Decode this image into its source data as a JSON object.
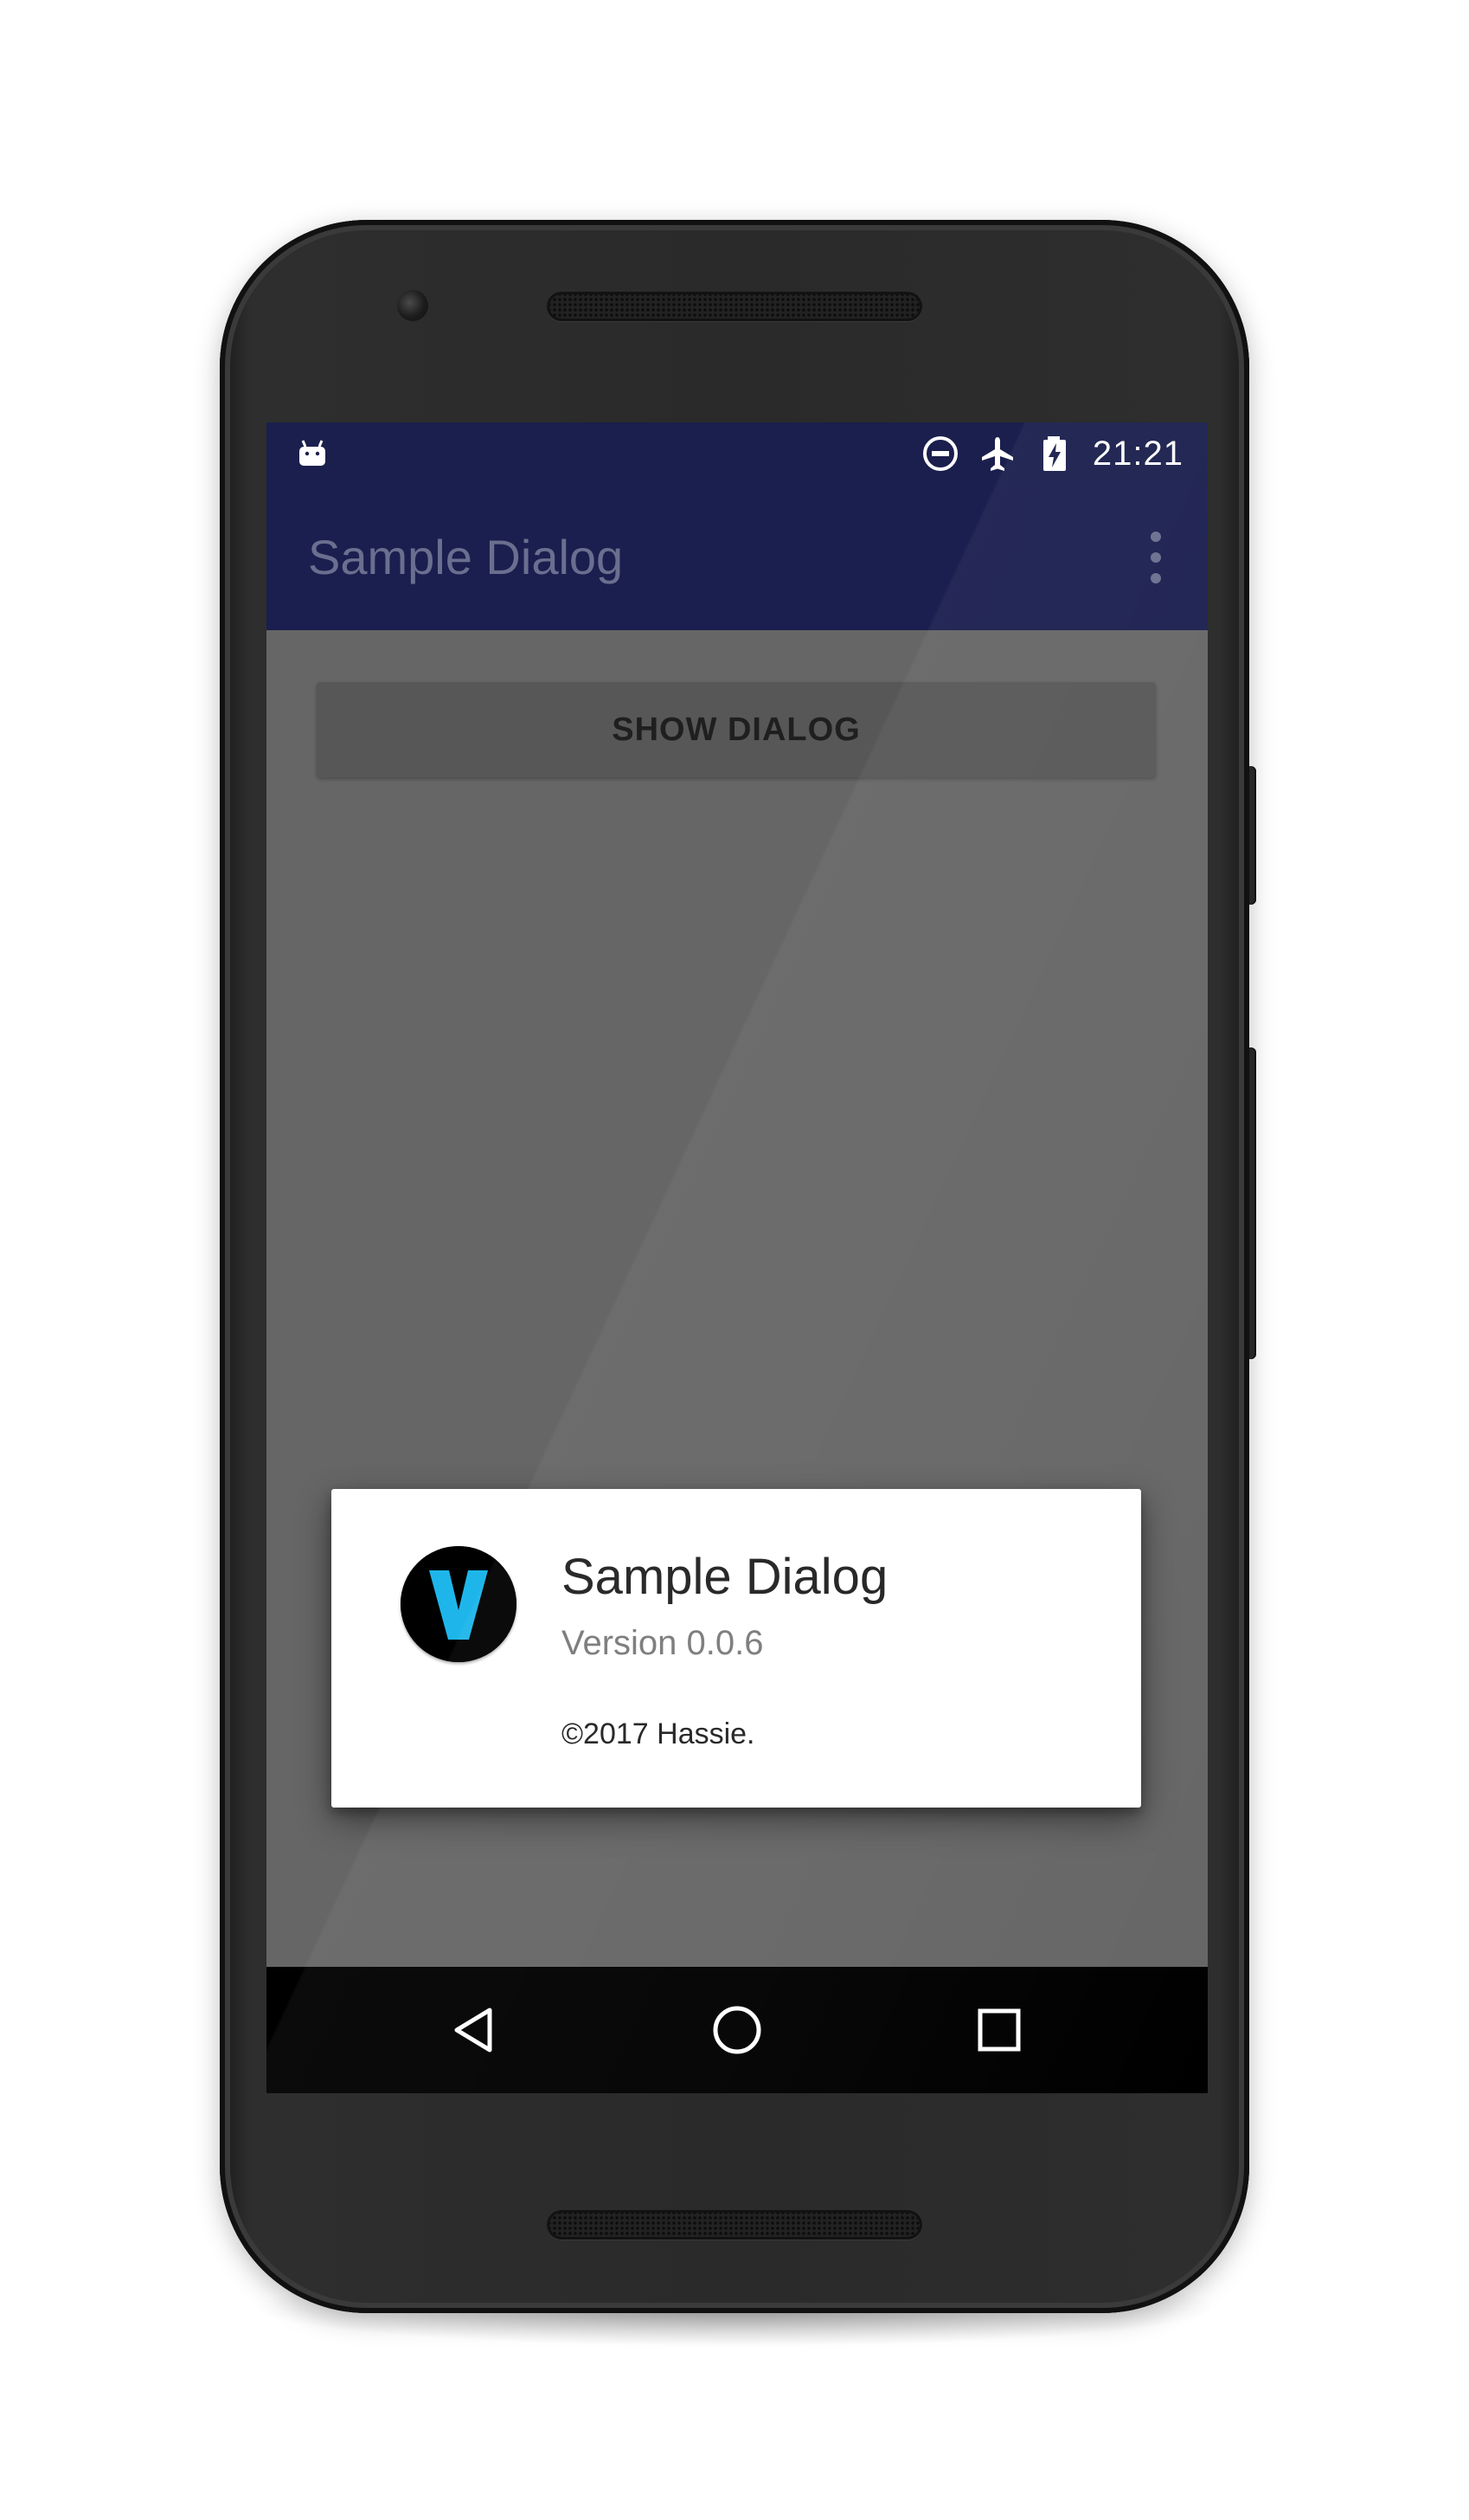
{
  "status_bar": {
    "time": "21:21",
    "icons": [
      "android-debug-icon",
      "do-not-disturb-icon",
      "airplane-mode-icon",
      "battery-charging-icon"
    ]
  },
  "app_bar": {
    "title": "Sample Dialog",
    "overflow_icon": "more-vert-icon"
  },
  "main": {
    "show_dialog_label": "SHOW DIALOG"
  },
  "dialog": {
    "logo_letter": "V",
    "title": "Sample Dialog",
    "version": "Version 0.0.6",
    "copyright": "©2017 Hassie."
  },
  "nav_bar": {
    "buttons": [
      "back-icon",
      "home-icon",
      "recents-icon"
    ]
  },
  "colors": {
    "status_bar": "#1a1f4d",
    "app_bar": "#1b1f4f",
    "scrim_background": "#666666",
    "dialog_background": "#ffffff",
    "logo_accent": "#1eb6ea",
    "nav_bar": "#000000"
  }
}
